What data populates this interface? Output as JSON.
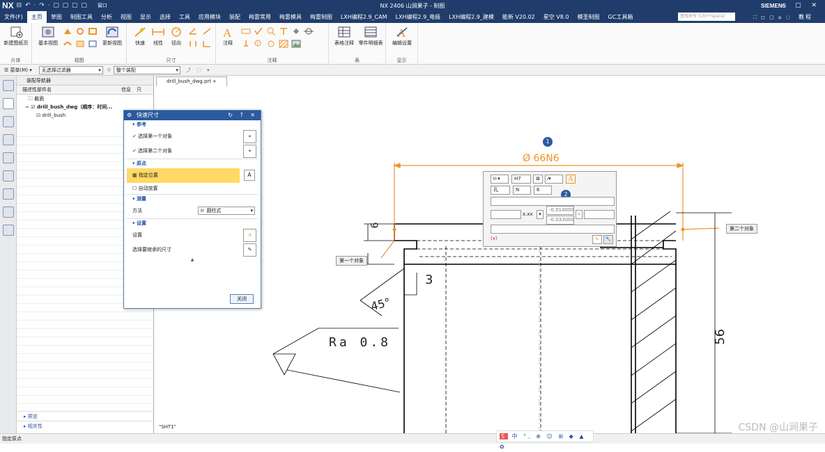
{
  "title_bar": {
    "logo": "NX",
    "title": "NX 2406 山涧果子 - 制图",
    "window_menu": "窗口",
    "brand": "SIEMENS",
    "quick_access": "⊟ ↶ · ↷ · ▢ ▢ ▢ ▢"
  },
  "menu": {
    "items": [
      "文件(F)",
      "主页",
      "草图",
      "制图工具",
      "分析",
      "视图",
      "显示",
      "选择",
      "工具",
      "应用模块",
      "装配",
      "梅雷常用",
      "梅雷模具",
      "梅雷制图",
      "LXH编程2.9_CAM",
      "LXH编程2.9_电极",
      "LXH编程2.9_建模",
      "能新 V20.02",
      "星空 V8.0",
      "模圣制图",
      "GC工具箱"
    ],
    "search_placeholder": "查找命令 (Ctrl+Space)",
    "help_label": "教程"
  },
  "ribbon": {
    "sheet": {
      "new_sheet": "新建图纸页",
      "group": "片体"
    },
    "view": {
      "base_view": "基本视图",
      "update_view": "更新视图",
      "group": "视图"
    },
    "dimension": {
      "quick": "快速",
      "linear": "线性",
      "radial": "径向",
      "group": "尺寸"
    },
    "annotation": {
      "note": "注释",
      "group": "注释"
    },
    "table": {
      "table_note": "表格注释",
      "parts_list": "零件明细表",
      "group": "表"
    },
    "display": {
      "edit_settings": "编辑设置",
      "group": "显示"
    }
  },
  "toolbar2": {
    "menu": "菜单(M)",
    "filter": "无选择过滤器",
    "scope": "整个装配"
  },
  "navigator": {
    "title": "装配导航器",
    "columns": {
      "name": "描述性部件名",
      "info": "信息",
      "readonly": "只"
    },
    "rows": [
      "截面",
      "drill_bush_dwg（顺序：时间...",
      "drill_bush"
    ],
    "preview": "预览",
    "dependencies": "相关性"
  },
  "drawing_tab": {
    "label": "drill_bush_dwg.prt"
  },
  "dialog": {
    "title": "快速尺寸",
    "ref_section": "参考",
    "first_obj": "选择第一个对象",
    "second_obj": "选择第二个对象",
    "origin_section": "原点",
    "specify_location": "指定位置",
    "auto_place": "自动放置",
    "measure_section": "测量",
    "method_label": "方法",
    "method_value": "圆柱式",
    "settings_section": "设置",
    "settings_label": "设置",
    "inherit_label": "选择要继承的尺寸",
    "close_label": "关闭"
  },
  "drawing": {
    "dim_diameter": "Ø 66N6",
    "dim_six": "6",
    "dim_three": "3",
    "dim_angle": "45°",
    "roughness": "Ra 0.8",
    "dim_56": "56",
    "sheet_name": "\"SHT1\"",
    "first_obj_tag": "第一个对象",
    "second_obj_tag": "第二个对象",
    "marker1": "1",
    "marker2": "2"
  },
  "popup": {
    "tolerance_class": "H7",
    "fit_type": "孔",
    "letter": "N",
    "grade": "6",
    "format": "x.xx",
    "upper_tol": "-0.014000",
    "lower_tol": "-0.033000",
    "expr": "(x)"
  },
  "status": {
    "prompt": "指定原点"
  },
  "ime": {
    "text": "中 °, ⊕ ☺ ⊞ ◆ ▲ ✿"
  },
  "watermark": "CSDN @山涧果子",
  "colors": {
    "title_bg": "#1f3c6b",
    "accent": "#2b5aa0",
    "highlight": "#ffd966",
    "dim_orange": "#f0932b"
  }
}
